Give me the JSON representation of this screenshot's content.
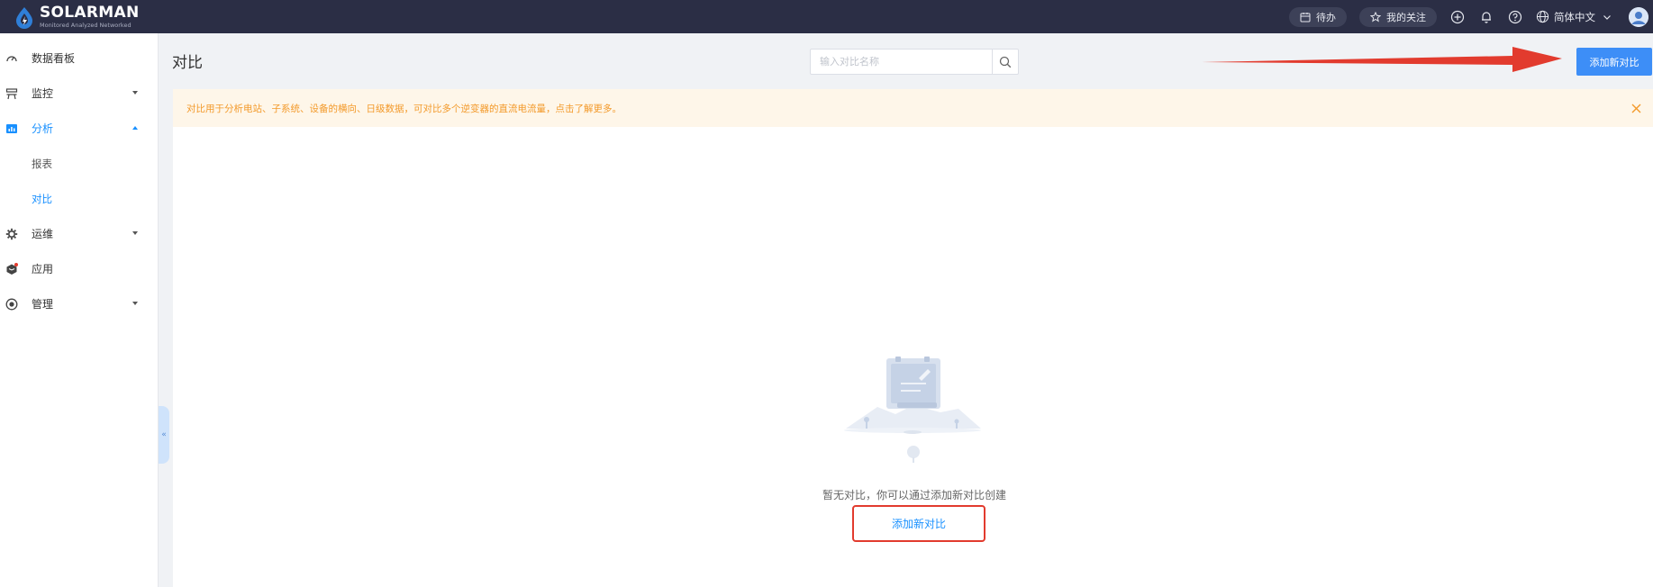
{
  "brand": {
    "name": "SOLARMAN",
    "tagline": "Monitored Analyzed Networked"
  },
  "topbar": {
    "todo_label": "待办",
    "follow_label": "我的关注",
    "language_label": "简体中文"
  },
  "sidebar": {
    "items": [
      {
        "label": "数据看板"
      },
      {
        "label": "监控"
      },
      {
        "label": "分析"
      },
      {
        "label": "报表"
      },
      {
        "label": "对比"
      },
      {
        "label": "运维"
      },
      {
        "label": "应用"
      },
      {
        "label": "管理"
      }
    ]
  },
  "page": {
    "title": "对比",
    "search_placeholder": "输入对比名称",
    "add_button_label": "添加新对比",
    "notice_text": "对比用于分析电站、子系统、设备的横向、日级数据，可对比多个逆变器的直流电流量，点击了解更多。",
    "empty_text": "暂无对比，你可以通过添加新对比创建",
    "empty_link_label": "添加新对比"
  },
  "colors": {
    "topbar_bg": "#2b2e45",
    "accent": "#1890ff",
    "primary_button": "#3d8ef7",
    "notice_bg": "#fef6e9",
    "notice_text": "#f39a2b",
    "annotation_red": "#e23b2e"
  }
}
